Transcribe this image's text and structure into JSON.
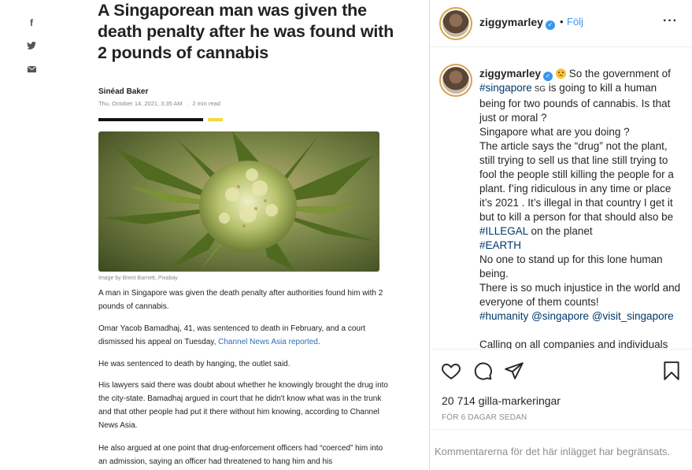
{
  "article": {
    "share_icons": [
      "facebook-icon",
      "twitter-icon",
      "email-icon"
    ],
    "headline": "A Singaporean man was given the death penalty after he was found with 2 pounds of cannabis",
    "author": "Sinéad Baker",
    "date": "Thu, October 14, 2021, 3:35 AM",
    "read_time": "2 min read",
    "image_caption": "Image by Brent Barnett, Pixabay",
    "paragraphs": {
      "p1": "A man in Singapore was given the death penalty after authorities found him with 2 pounds of cannabis.",
      "p2_text": "Omar Yacob Bamadhaj, 41, was sentenced to death in February, and a court dismissed his appeal on Tuesday, ",
      "p2_link": "Channel News Asia reported",
      "p2_end": ".",
      "p3": "He was sentenced to death by hanging, the outlet said.",
      "p4": "His lawyers said there was doubt about whether he knowingly brought the drug into the city-state. Bamadhaj argued in court that he didn't know what was in the trunk and that other people had put it there without him knowing, according to Channel News Asia.",
      "p5": "He also argued at one point that drug-enforcement officers had “coerced” him into an admission, saying an officer had threatened to hang him and his"
    },
    "colors": {
      "accent_bar": "#111111",
      "accent_yellow": "#f2da3b",
      "link": "#2a6fb5"
    }
  },
  "post": {
    "username": "ziggymarley",
    "follow_label": "Följ",
    "caption": {
      "line1_rest": " So the government of ",
      "tag_singapore": "#singapore",
      "flag": " SG",
      "line_a": " is going to kill a human being for two pounds of cannabis. Is that just or moral ?",
      "line_b": "Singapore what are you doing ?",
      "line_c": "The article says the “drug” not the plant, still trying to sell us that line still trying to fool the people still killing the people for a plant. f’ing ridiculous in any time or place it’s 2021 . It’s illegal in that country I get it but to kill a person for that should also be ",
      "tag_illegal": "#ILLEGAL",
      "line_c_end": " on the planet",
      "tag_earth": "#EARTH",
      "line_d": "No one to stand up for this lone human being.",
      "line_e": "There is so much injustice in the world and everyone of them counts!",
      "tag_humanity": "#humanity",
      "mention_singapore": "@singapore",
      "mention_visit": "@visit_singapore",
      "line_f": "Calling on all companies and individuals"
    },
    "likes": "20 714 gilla-markeringar",
    "posted": "FÖR 6 DAGAR SEDAN",
    "comments_restricted": "Kommentarerna för det här inlägget har begränsats.",
    "colors": {
      "link": "#3897f0",
      "tag": "#00376b",
      "muted": "#8e8e8e"
    }
  }
}
